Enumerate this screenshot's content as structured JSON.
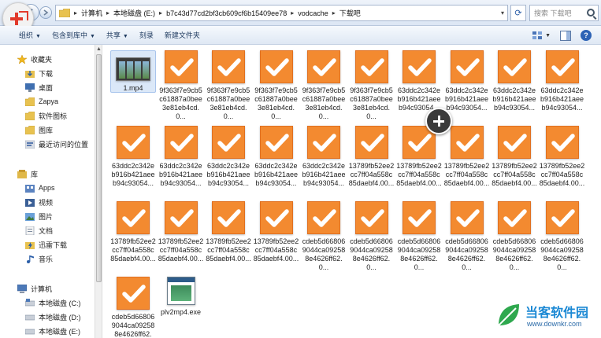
{
  "address": {
    "segments": [
      "计算机",
      "本地磁盘 (E:)",
      "b7c43d77cd2bf3cb609cf6b15409ee78",
      "vodcache",
      "下载吧"
    ],
    "search_placeholder": "搜索 下载吧"
  },
  "toolbar": {
    "organize": "组织",
    "include": "包含到库中",
    "share": "共享",
    "burn": "刻录",
    "new_folder": "新建文件夹"
  },
  "nav": {
    "favorites": "收藏夹",
    "downloads": "下载",
    "desktop": "桌面",
    "zapya": "Zapya",
    "software_icons": "软件图标",
    "library_folder": "图库",
    "recent": "最近访问的位置",
    "libraries": "库",
    "apps": "Apps",
    "videos": "视频",
    "pictures": "图片",
    "documents": "文档",
    "thunder": "迅雷下载",
    "music": "音乐",
    "computer": "计算机",
    "drive_c": "本地磁盘 (C:)",
    "drive_d": "本地磁盘 (D:)",
    "drive_e": "本地磁盘 (E:)"
  },
  "files": [
    {
      "name": "1.mp4",
      "kind": "video"
    },
    {
      "name": "9f363f7e9cb5c61887a0bee3e81eb4cd.0...",
      "kind": "check"
    },
    {
      "name": "9f363f7e9cb5c61887a0bee3e81eb4cd.0...",
      "kind": "check"
    },
    {
      "name": "9f363f7e9cb5c61887a0bee3e81eb4cd.0...",
      "kind": "check"
    },
    {
      "name": "9f363f7e9cb5c61887a0bee3e81eb4cd.0...",
      "kind": "check"
    },
    {
      "name": "9f363f7e9cb5c61887a0bee3e81eb4cd.0...",
      "kind": "check"
    },
    {
      "name": "63ddc2c342eb916b421aeeb94c93054...",
      "kind": "check"
    },
    {
      "name": "63ddc2c342eb916b421aeeb94c93054...",
      "kind": "check"
    },
    {
      "name": "63ddc2c342eb916b421aeeb94c93054...",
      "kind": "check"
    },
    {
      "name": "63ddc2c342eb916b421aeeb94c93054...",
      "kind": "check"
    },
    {
      "name": "63ddc2c342eb916b421aeeb94c93054...",
      "kind": "check"
    },
    {
      "name": "63ddc2c342eb916b421aeeb94c93054...",
      "kind": "check"
    },
    {
      "name": "63ddc2c342eb916b421aeeb94c93054...",
      "kind": "check"
    },
    {
      "name": "63ddc2c342eb916b421aeeb94c93054...",
      "kind": "check"
    },
    {
      "name": "63ddc2c342eb916b421aeeb94c93054...",
      "kind": "check"
    },
    {
      "name": "13789fb52ee2cc7ff04a558c85daebf4.00...",
      "kind": "check"
    },
    {
      "name": "13789fb52ee2cc7ff04a558c85daebf4.00...",
      "kind": "check"
    },
    {
      "name": "13789fb52ee2cc7ff04a558c85daebf4.00...",
      "kind": "check"
    },
    {
      "name": "13789fb52ee2cc7ff04a558c85daebf4.00...",
      "kind": "check"
    },
    {
      "name": "13789fb52ee2cc7ff04a558c85daebf4.00...",
      "kind": "check"
    },
    {
      "name": "13789fb52ee2cc7ff04a558c85daebf4.00...",
      "kind": "check"
    },
    {
      "name": "13789fb52ee2cc7ff04a558c85daebf4.00...",
      "kind": "check"
    },
    {
      "name": "13789fb52ee2cc7ff04a558c85daebf4.00...",
      "kind": "check"
    },
    {
      "name": "13789fb52ee2cc7ff04a558c85daebf4.00...",
      "kind": "check"
    },
    {
      "name": "cdeb5d668069044ca092588e4626ff62.0...",
      "kind": "check"
    },
    {
      "name": "cdeb5d668069044ca092588e4626ff62.0...",
      "kind": "check"
    },
    {
      "name": "cdeb5d668069044ca092588e4626ff62.0...",
      "kind": "check"
    },
    {
      "name": "cdeb5d668069044ca092588e4626ff62.0...",
      "kind": "check"
    },
    {
      "name": "cdeb5d668069044ca092588e4626ff62.0...",
      "kind": "check"
    },
    {
      "name": "cdeb5d668069044ca092588e4626ff62.0...",
      "kind": "check"
    },
    {
      "name": "cdeb5d668069044ca092588e4626ff62.0...",
      "kind": "check"
    },
    {
      "name": "plv2mp4.exe",
      "kind": "exe"
    }
  ],
  "watermark": {
    "title": "当客软件园",
    "url": "www.downkr.com"
  },
  "colors": {
    "check_orange": "#f38a30",
    "toolbar_text": "#1e3a5f",
    "watermark_blue": "#1a88d4"
  }
}
